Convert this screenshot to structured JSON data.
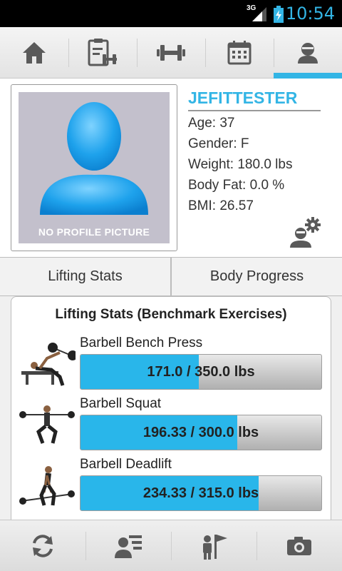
{
  "status_bar": {
    "network": "3G",
    "time": "10:54"
  },
  "top_nav": {
    "tabs": [
      "home-icon",
      "logs-icon",
      "dumbbell-icon",
      "calendar-icon",
      "profile-icon"
    ],
    "active_tab": "profile-icon",
    "accent_color": "#33b5e5"
  },
  "profile": {
    "picture_caption": "NO PROFILE PICTURE",
    "username": "JEFITTESTER",
    "age": "Age: 37",
    "gender": "Gender: F",
    "weight": "Weight: 180.0 lbs",
    "body_fat": "Body Fat: 0.0 %",
    "bmi": "BMI: 26.57"
  },
  "tabs": {
    "lifting": "Lifting Stats",
    "body": "Body Progress"
  },
  "lifting_card": {
    "title": "Lifting Stats (Benchmark Exercises)",
    "exercises": [
      {
        "name": "Barbell Bench Press",
        "current": 171.0,
        "goal": 350.0,
        "label": "171.0 / 350.0 lbs",
        "progress": 0.49
      },
      {
        "name": "Barbell Squat",
        "current": 196.33,
        "goal": 300.0,
        "label": "196.33 / 300.0 lbs",
        "progress": 0.65
      },
      {
        "name": "Barbell Deadlift",
        "current": 234.33,
        "goal": 315.0,
        "label": "234.33 / 315.0 lbs",
        "progress": 0.74
      }
    ]
  },
  "bottom_bar": {
    "buttons": [
      "sync-icon",
      "profile-list-icon",
      "goals-icon",
      "camera-icon"
    ]
  }
}
